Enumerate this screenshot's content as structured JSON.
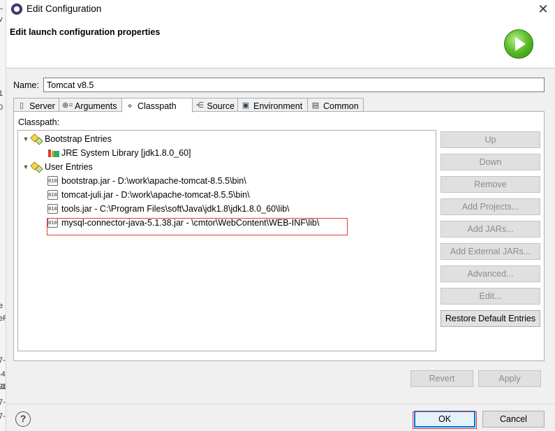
{
  "window": {
    "title": "Edit Configuration",
    "close_glyph": "✕"
  },
  "header": {
    "title": "Edit launch configuration properties",
    "icon": "run-icon"
  },
  "name_field": {
    "label": "Name:",
    "value": "Tomcat v8.5"
  },
  "tabs": [
    {
      "label": "Server",
      "icon": "server-icon"
    },
    {
      "label": "Arguments",
      "icon": "arguments-icon"
    },
    {
      "label": "Classpath",
      "icon": "classpath-icon",
      "active": true
    },
    {
      "label": "Source",
      "icon": "source-icon"
    },
    {
      "label": "Environment",
      "icon": "environment-icon"
    },
    {
      "label": "Common",
      "icon": "common-icon"
    }
  ],
  "classpath": {
    "label": "Classpath:",
    "tree": [
      {
        "label": "Bootstrap Entries",
        "type": "category",
        "expanded": true
      },
      {
        "label": "JRE System Library [jdk1.8.0_60]",
        "type": "library"
      },
      {
        "label": "User Entries",
        "type": "category",
        "expanded": true
      },
      {
        "label": "bootstrap.jar - D:\\work\\apache-tomcat-8.5.5\\bin\\",
        "type": "jar"
      },
      {
        "label": "tomcat-juli.jar - D:\\work\\apache-tomcat-8.5.5\\bin\\",
        "type": "jar"
      },
      {
        "label": "tools.jar - C:\\Program Files\\soft\\Java\\jdk1.8\\jdk1.8.0_60\\lib\\",
        "type": "jar"
      },
      {
        "label": "mysql-connector-java-5.1.38.jar - \\cmtor\\WebContent\\WEB-INF\\lib\\",
        "type": "jar",
        "highlighted": true
      }
    ],
    "jar_icon_text": "010",
    "expand_glyph": "▼"
  },
  "side_buttons": [
    {
      "label": "Up",
      "enabled": false
    },
    {
      "label": "Down",
      "enabled": false
    },
    {
      "label": "Remove",
      "enabled": false
    },
    {
      "label": "Add Projects...",
      "enabled": false
    },
    {
      "label": "Add JARs...",
      "enabled": false
    },
    {
      "label": "Add External JARs...",
      "enabled": false
    },
    {
      "label": "Advanced...",
      "enabled": false
    },
    {
      "label": "Edit...",
      "enabled": false
    },
    {
      "label": "Restore Default Entries",
      "enabled": true
    }
  ],
  "footer": {
    "revert": "Revert",
    "apply": "Apply",
    "ok": "OK",
    "cancel": "Cancel",
    "help_glyph": "?"
  },
  "background_fragments": [
    "_",
    "v",
    "1",
    "0",
    "e",
    "eF",
    "7-",
    "-4",
    "-0",
    "20",
    "7-",
    "7-"
  ],
  "colors": {
    "highlight_border": "#e03c3c",
    "default_button_border": "#0078d7"
  }
}
